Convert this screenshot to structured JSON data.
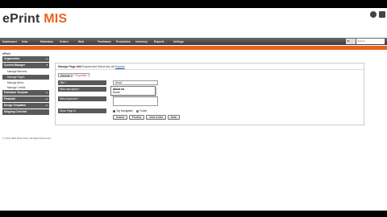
{
  "header": {
    "logo_part1": "ePrint",
    "logo_part2": " MIS"
  },
  "nav": {
    "items": [
      "Dashboard",
      "Jobs",
      "Estimates",
      "Orders",
      "Web",
      "Purchases",
      "Production",
      "Inventory",
      "Reports",
      "Settings"
    ],
    "search_scope": "All",
    "search_placeholder": "Search..."
  },
  "breadcrumb": "Home » Content Manager » Manage Pages » Manage Page Add",
  "sidebar": {
    "title": "ePrint",
    "groups": [
      {
        "label": "Organization",
        "arrow": "▸"
      },
      {
        "label": "Content Manager",
        "arrow": "▾"
      }
    ],
    "sub_items": [
      "Manage Banners",
      "Manage Pages",
      "Manage Menu",
      "Manage Credits"
    ],
    "bottom_groups": [
      {
        "label": "Estimates Template",
        "arrow": "▸"
      },
      {
        "label": "Financial",
        "arrow": "▸"
      },
      {
        "label": "Design Templates",
        "arrow": "▸"
      },
      {
        "label": "Shipping Cost Info",
        "arrow": ""
      }
    ]
  },
  "main": {
    "heading": "Manage Page Add",
    "heading_note": "Expand and Select any Url",
    "heading_link": "Expand",
    "tabs": [
      "General",
      "Properties"
    ],
    "labels": {
      "title": "Title *",
      "meta_description": "Meta description *",
      "meta_keywords": "Meta keywords *",
      "show_page_in": "Show Page In"
    },
    "title_value": "About",
    "dropdown_options": [
      "About Us",
      "Home"
    ],
    "radio_options": [
      "Top Navigation",
      "Footer"
    ],
    "buttons": [
      "Submit",
      "Preview",
      "Save & Add",
      "Back"
    ]
  },
  "footer": "© ePrint MIS 2011-2014. All Rights Reserved"
}
